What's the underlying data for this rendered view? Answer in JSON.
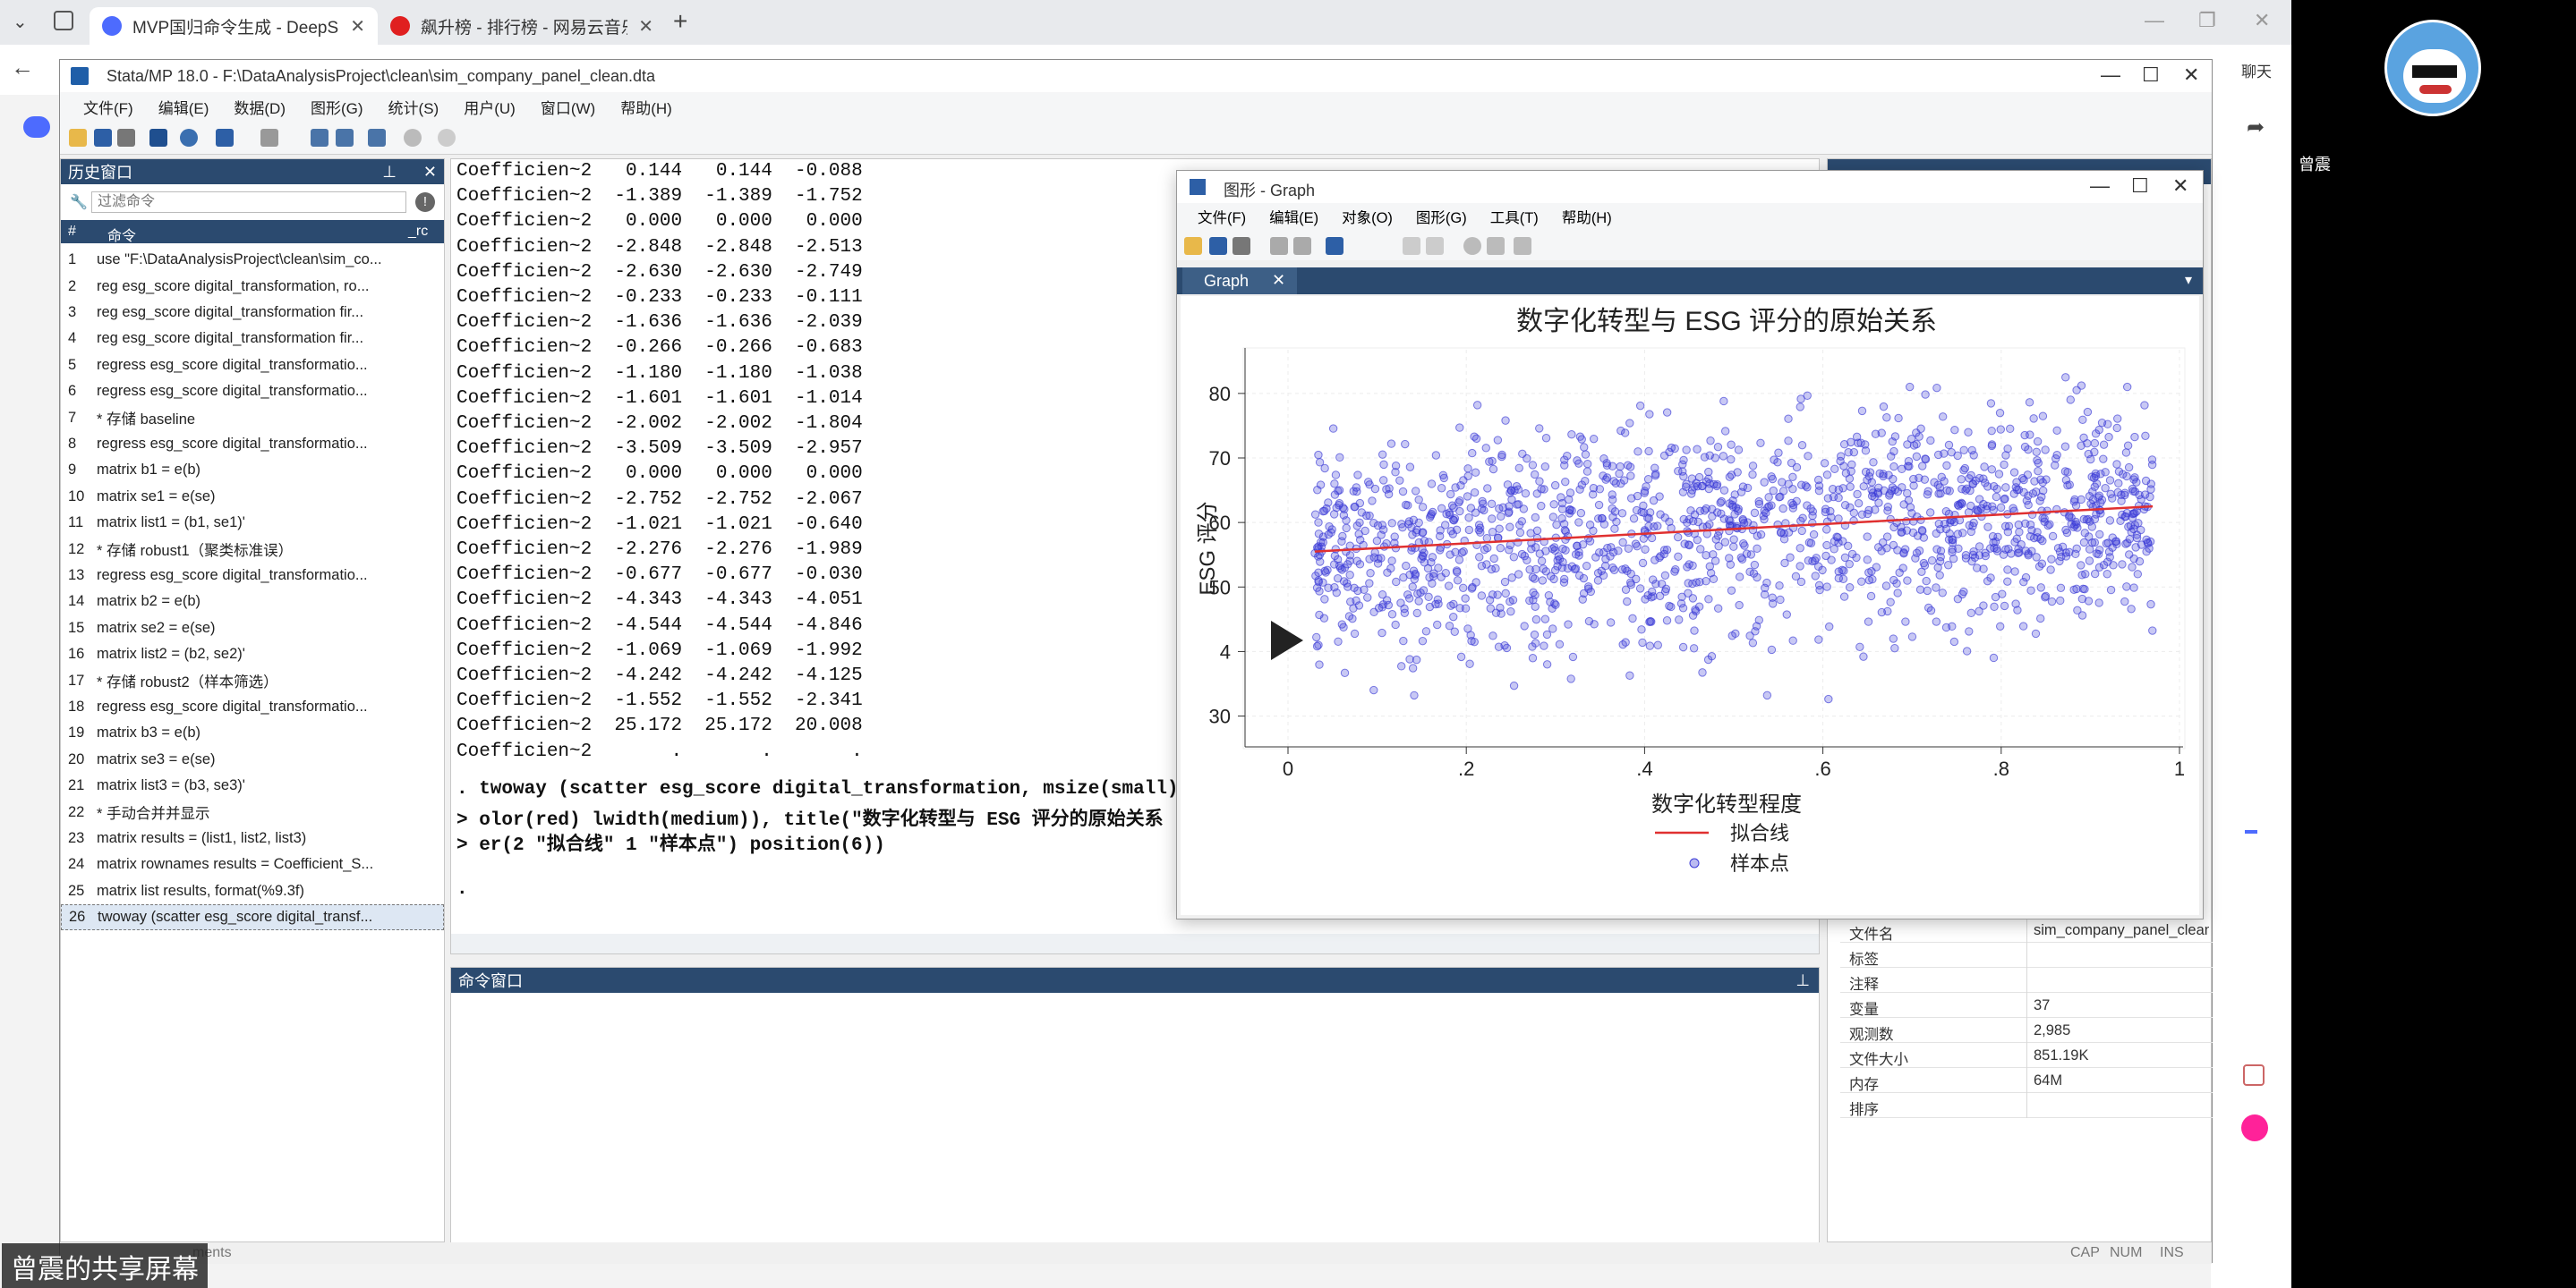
{
  "browser": {
    "tabs": [
      {
        "label": "MVP国归命令生成 - DeepSeek",
        "active": true
      },
      {
        "label": "飙升榜 - 排行榜 - 网易云音乐",
        "active": false
      }
    ],
    "right_label": "聊天"
  },
  "stata": {
    "title": "Stata/MP 18.0 - F:\\DataAnalysisProject\\clean\\sim_company_panel_clean.dta",
    "menu": [
      "文件(F)",
      "编辑(E)",
      "数据(D)",
      "图形(G)",
      "统计(S)",
      "用户(U)",
      "窗口(W)",
      "帮助(H)"
    ],
    "history": {
      "title": "历史窗口",
      "filter_placeholder": "过滤命令",
      "col_num": "#",
      "col_cmd": "命令",
      "col_rc": "_rc",
      "rows": [
        {
          "n": "1",
          "cmd": "use \"F:\\DataAnalysisProject\\clean\\sim_co..."
        },
        {
          "n": "2",
          "cmd": "reg esg_score digital_transformation, ro..."
        },
        {
          "n": "3",
          "cmd": "reg esg_score digital_transformation fir..."
        },
        {
          "n": "4",
          "cmd": "reg esg_score digital_transformation fir..."
        },
        {
          "n": "5",
          "cmd": "regress esg_score digital_transformatio..."
        },
        {
          "n": "6",
          "cmd": "regress esg_score digital_transformatio..."
        },
        {
          "n": "7",
          "cmd": "* 存储 baseline"
        },
        {
          "n": "8",
          "cmd": "regress esg_score digital_transformatio..."
        },
        {
          "n": "9",
          "cmd": "matrix b1 = e(b)"
        },
        {
          "n": "10",
          "cmd": "matrix se1 = e(se)"
        },
        {
          "n": "11",
          "cmd": "matrix list1 = (b1, se1)'"
        },
        {
          "n": "12",
          "cmd": "* 存储 robust1（聚类标准误）"
        },
        {
          "n": "13",
          "cmd": "regress esg_score digital_transformatio..."
        },
        {
          "n": "14",
          "cmd": "matrix b2 = e(b)"
        },
        {
          "n": "15",
          "cmd": "matrix se2 = e(se)"
        },
        {
          "n": "16",
          "cmd": "matrix list2 = (b2, se2)'"
        },
        {
          "n": "17",
          "cmd": "* 存储 robust2（样本筛选）"
        },
        {
          "n": "18",
          "cmd": "regress esg_score digital_transformatio..."
        },
        {
          "n": "19",
          "cmd": "matrix b3 = e(b)"
        },
        {
          "n": "20",
          "cmd": "matrix se3 = e(se)"
        },
        {
          "n": "21",
          "cmd": "matrix list3 = (b3, se3)'"
        },
        {
          "n": "22",
          "cmd": "* 手动合并并显示"
        },
        {
          "n": "23",
          "cmd": "matrix results = (list1, list2, list3)"
        },
        {
          "n": "24",
          "cmd": "matrix rownames results = Coefficient_S..."
        },
        {
          "n": "25",
          "cmd": "matrix list results, format(%9.3f)"
        },
        {
          "n": "26",
          "cmd": "twoway (scatter esg_score digital_transf..."
        }
      ]
    },
    "results_lines": [
      "Coefficien~2   0.144   0.144  -0.088",
      "Coefficien~2  -1.389  -1.389  -1.752",
      "Coefficien~2   0.000   0.000   0.000",
      "Coefficien~2  -2.848  -2.848  -2.513",
      "Coefficien~2  -2.630  -2.630  -2.749",
      "Coefficien~2  -0.233  -0.233  -0.111",
      "Coefficien~2  -1.636  -1.636  -2.039",
      "Coefficien~2  -0.266  -0.266  -0.683",
      "Coefficien~2  -1.180  -1.180  -1.038",
      "Coefficien~2  -1.601  -1.601  -1.014",
      "Coefficien~2  -2.002  -2.002  -1.804",
      "Coefficien~2  -3.509  -3.509  -2.957",
      "Coefficien~2   0.000   0.000   0.000",
      "Coefficien~2  -2.752  -2.752  -2.067",
      "Coefficien~2  -1.021  -1.021  -0.640",
      "Coefficien~2  -2.276  -2.276  -1.989",
      "Coefficien~2  -0.677  -0.677  -0.030",
      "Coefficien~2  -4.343  -4.343  -4.051",
      "Coefficien~2  -4.544  -4.544  -4.846",
      "Coefficien~2  -1.069  -1.069  -1.992",
      "Coefficien~2  -4.242  -4.242  -4.125",
      "Coefficien~2  -1.552  -1.552  -2.341",
      "Coefficien~2  25.172  25.172  20.008",
      "Coefficien~2       .       .       ."
    ],
    "cmd_echo": [
      ". twoway (scatter esg_score digital_transformation, msize(small) mc",
      "> olor(red) lwidth(medium)), title(\"数字化转型与 ESG 评分的原始关系",
      "> er(2 \"拟合线\" 1 \"样本点\") position(6))",
      "."
    ],
    "command_window_title": "命令窗口",
    "properties": [
      {
        "k": "文件名",
        "v": "sim_company_panel_clean."
      },
      {
        "k": "标签",
        "v": ""
      },
      {
        "k": "注释",
        "v": ""
      },
      {
        "k": "变量",
        "v": "37"
      },
      {
        "k": "观测数",
        "v": "2,985"
      },
      {
        "k": "文件大小",
        "v": "851.19K"
      },
      {
        "k": "内存",
        "v": "64M"
      },
      {
        "k": "排序",
        "v": ""
      }
    ],
    "status_left": "ments",
    "status_right": [
      "CAP",
      "NUM",
      "INS"
    ]
  },
  "graph": {
    "window_title": "图形 - Graph",
    "menu": [
      "文件(F)",
      "编辑(E)",
      "对象(O)",
      "图形(G)",
      "工具(T)",
      "帮助(H)"
    ],
    "tab_label": "Graph"
  },
  "chart_data": {
    "type": "scatter",
    "title": "数字化转型与 ESG 评分的原始关系",
    "xlabel": "数字化转型程度",
    "ylabel": "ESG 评分",
    "xlim": [
      0,
      1
    ],
    "ylim": [
      28,
      84
    ],
    "xticks": [
      "0",
      ".2",
      ".4",
      ".6",
      ".8",
      "1"
    ],
    "yticks": [
      "30",
      "4",
      "50",
      "60",
      "70",
      "80"
    ],
    "n_points": 2985,
    "fit_line": {
      "x": [
        0.03,
        0.97
      ],
      "y": [
        55.5,
        62.5
      ],
      "color": "#e03030"
    },
    "point_color": "#3b3bd6",
    "legend": [
      "拟合线",
      "样本点"
    ],
    "legend_position": "bottom"
  },
  "overlay": {
    "share_label": "曾震的共享屏幕",
    "user_label": "曾震"
  }
}
